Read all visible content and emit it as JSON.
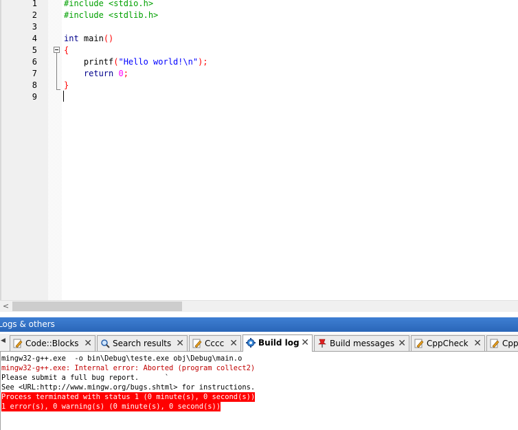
{
  "editor": {
    "line_numbers": [
      "1",
      "2",
      "3",
      "4",
      "5",
      "6",
      "7",
      "8",
      "9"
    ],
    "lines": {
      "l1": "#include <stdio.h>",
      "l2": "#include <stdlib.h>",
      "l4_kw": "int",
      "l4_id": " main",
      "l4_op": "()",
      "l5_op": "{",
      "l6_id": "    printf",
      "l6_op1": "(",
      "l6_str": "\"Hello world!\\n\"",
      "l6_op2": ");",
      "l7_kw": "    return",
      "l7_num": " 0",
      "l7_op": ";",
      "l8_op": "}"
    }
  },
  "scrollbar": {
    "left_arrow": "<"
  },
  "logs_panel": {
    "title": "Logs & others",
    "tab_scroll_left": "◀",
    "tabs": [
      {
        "label": "Code::Blocks",
        "icon": "pencil-icon",
        "close": "✕"
      },
      {
        "label": "Search results",
        "icon": "search-icon",
        "close": "✕"
      },
      {
        "label": "Cccc",
        "icon": "pencil-icon",
        "close": "✕"
      },
      {
        "label": "Build log",
        "icon": "gear-icon",
        "close": "✕"
      },
      {
        "label": "Build messages",
        "icon": "pin-icon",
        "close": "✕"
      },
      {
        "label": "CppCheck",
        "icon": "pencil-icon",
        "close": "✕"
      },
      {
        "label": "CppC",
        "icon": "pencil-icon",
        "close": ""
      }
    ],
    "active_tab": "Build log",
    "log_lines": [
      "mingw32-g++.exe  -o bin\\Debug\\teste.exe obj\\Debug\\main.o",
      "mingw32-g++.exe: Internal error: Aborted (program collect2)",
      "Please submit a full bug report.      `",
      "See <URL:http://www.mingw.org/bugs.shtml> for instructions.",
      "Process terminated with status 1 (0 minute(s), 0 second(s))",
      "1 error(s), 0 warning(s) (0 minute(s), 0 second(s))"
    ]
  },
  "colors": {
    "preprocessor": "#00a000",
    "keyword": "#00008b",
    "string": "#0000ff",
    "number": "#ff00ff",
    "operator": "#ff0000",
    "error_text": "#c00000",
    "error_highlight": "#ff0000",
    "caption_bar": "#2a66b8"
  }
}
